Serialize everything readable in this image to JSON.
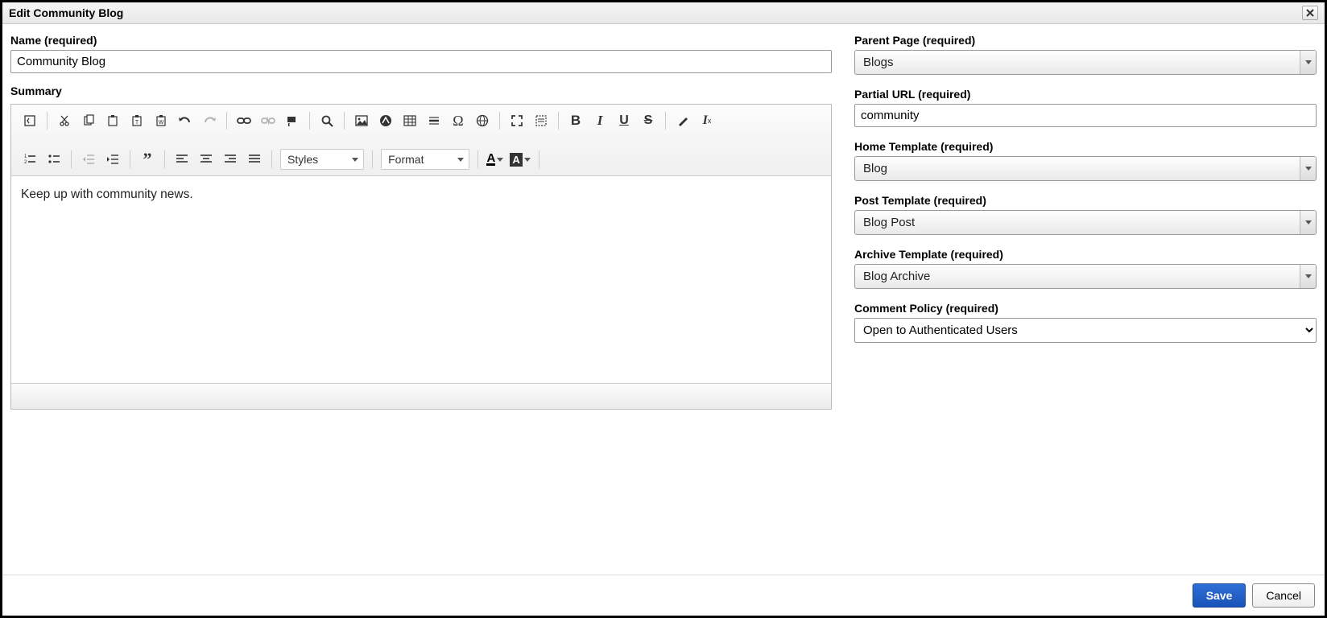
{
  "dialog": {
    "title": "Edit Community Blog"
  },
  "left": {
    "name_label": "Name (required)",
    "name_value": "Community Blog",
    "summary_label": "Summary",
    "summary_body": "Keep up with community news.",
    "toolbar": {
      "styles_label": "Styles",
      "format_label": "Format"
    }
  },
  "right": {
    "parent_page_label": "Parent Page (required)",
    "parent_page_value": "Blogs",
    "partial_url_label": "Partial URL (required)",
    "partial_url_value": "community",
    "home_template_label": "Home Template (required)",
    "home_template_value": "Blog",
    "post_template_label": "Post Template (required)",
    "post_template_value": "Blog Post",
    "archive_template_label": "Archive Template (required)",
    "archive_template_value": "Blog Archive",
    "comment_policy_label": "Comment Policy (required)",
    "comment_policy_value": "Open to Authenticated Users"
  },
  "footer": {
    "save": "Save",
    "cancel": "Cancel"
  }
}
